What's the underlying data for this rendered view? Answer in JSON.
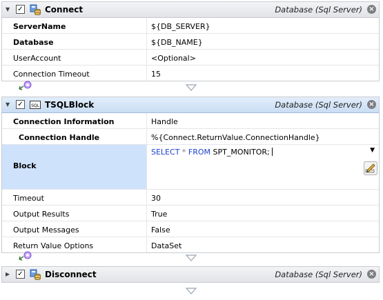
{
  "blocks": [
    {
      "title": "Connect",
      "type_label": "Database (Sql Server)",
      "rows": [
        {
          "label": "ServerName",
          "value": "${DB_SERVER}"
        },
        {
          "label": "Database",
          "value": "${DB_NAME}"
        },
        {
          "label": "UserAccount",
          "value": "<Optional>"
        },
        {
          "label": "Connection Timeout",
          "value": "15"
        }
      ]
    },
    {
      "title": "TSQLBlock",
      "type_label": "Database (Sql Server)",
      "rows": [
        {
          "label": "Connection Information",
          "value": "Handle"
        },
        {
          "label": "Connection Handle",
          "value": "%{Connect.ReturnValue.ConnectionHandle}"
        },
        {
          "label": "Block",
          "value": "SELECT * FROM SPT_MONITOR;",
          "sql": {
            "kw1": "SELECT",
            "op": "*",
            "kw2": "FROM",
            "rest": "SPT_MONITOR;"
          }
        },
        {
          "label": "Timeout",
          "value": "30"
        },
        {
          "label": "Output Results",
          "value": "True"
        },
        {
          "label": "Output Messages",
          "value": "False"
        },
        {
          "label": "Return Value Options",
          "value": "DataSet"
        }
      ]
    },
    {
      "title": "Disconnect",
      "type_label": "Database (Sql Server)"
    }
  ],
  "colors": {
    "accent": "#1c3fd0",
    "selected_row": "#cfe2fb",
    "selected_header": "#c9ddf3"
  },
  "icons": {
    "expanded": "triangle-down-icon",
    "collapsed": "triangle-right-icon",
    "close": "close-circle-icon",
    "connector": "connector-icon",
    "edit": "edit-pencil-icon"
  }
}
